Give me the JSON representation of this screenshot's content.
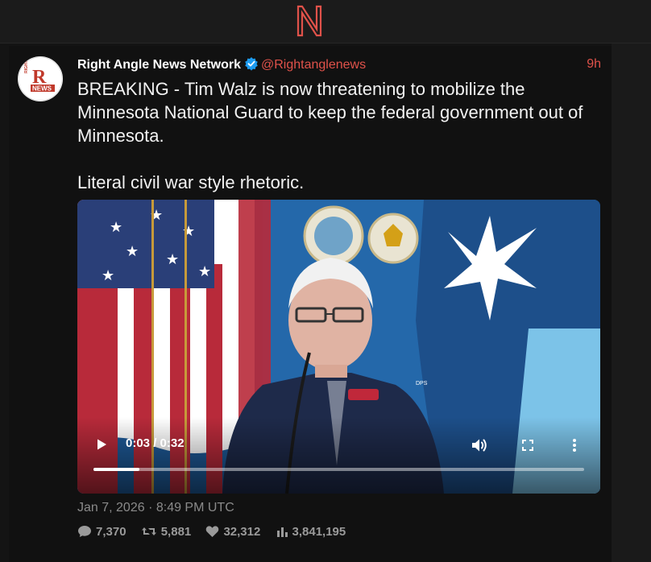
{
  "app": {
    "logo_letter": "N"
  },
  "tweet": {
    "author_name": "Right Angle News Network",
    "handle": "@Rightanglenews",
    "time_ago": "9h",
    "verified": true,
    "avatar": {
      "line1": "RIGHT ANGLE",
      "letter": "R",
      "line2": "NEWS"
    },
    "text_paragraphs": [
      "BREAKING - Tim Walz is now threatening to mobilize the Minnesota National Guard to keep the federal government out of Minnesota.",
      "Literal civil war style rhetoric."
    ],
    "timestamp": "Jan 7, 2026 · 8:49 PM UTC",
    "stats": {
      "replies": "7,370",
      "retweets": "5,881",
      "likes": "32,312",
      "views": "3,841,195"
    }
  },
  "video": {
    "timecode": "0:03 / 0:32",
    "progress_fraction": 0.094,
    "placard_text": "DPS"
  },
  "colors": {
    "accent": "#e0524a",
    "background": "#141414",
    "verified": "#1d9bf0"
  }
}
